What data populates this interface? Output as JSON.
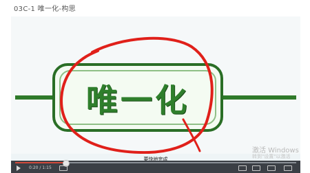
{
  "lesson": {
    "title": "03C-1 唯一化-构思"
  },
  "video": {
    "banner_text": "唯一化",
    "caption": "要快地完成",
    "time": "0:20 / 1:15",
    "progress": 0.18
  },
  "watermark": {
    "line1": "激活 Windows",
    "line2": "转到\"设置\"以激活 Windows。"
  },
  "colors": {
    "banner_green": "#2f7f2c",
    "annotation_red": "#e0201a",
    "control_bar": "#3b3f45"
  },
  "icons": [
    "play-icon",
    "volume-icon",
    "subtitle-icon",
    "settings-icon",
    "widescreen-icon",
    "fullscreen-icon"
  ]
}
